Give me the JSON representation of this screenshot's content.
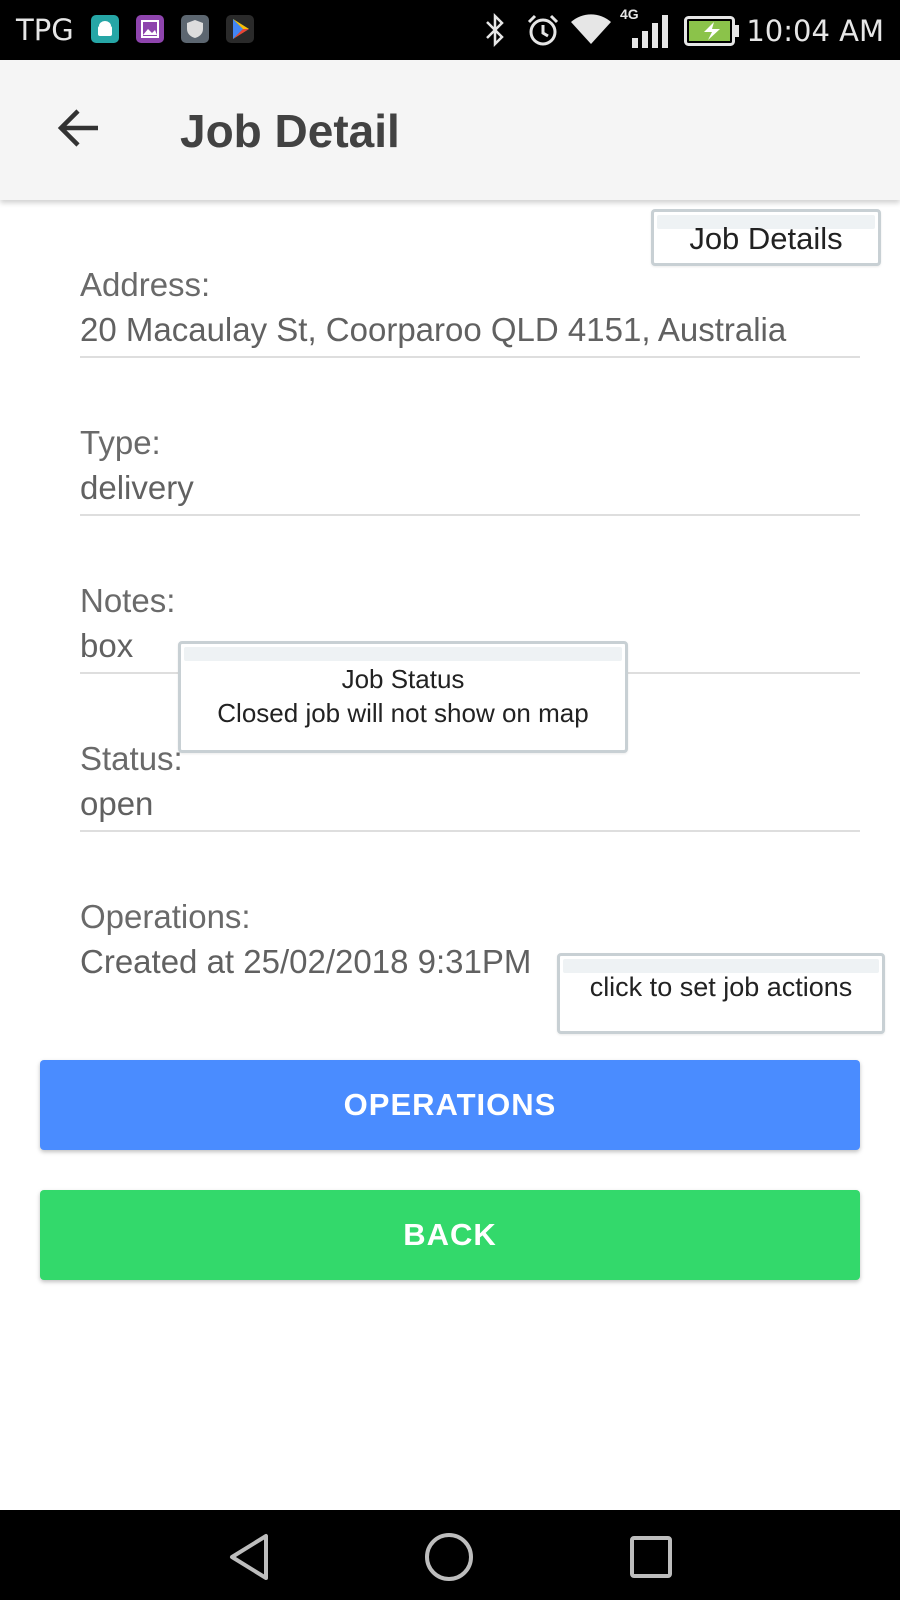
{
  "status_bar": {
    "carrier": "TPG",
    "network": "4G",
    "time": "10:04 AM",
    "icons": [
      "android-icon",
      "gallery-icon",
      "shield-icon",
      "play-store-icon",
      "bluetooth-icon",
      "alarm-icon",
      "wifi-icon",
      "signal-icon",
      "battery-icon"
    ]
  },
  "app_bar": {
    "title": "Job Detail",
    "back_icon": "arrow-left-icon"
  },
  "fields": {
    "address": {
      "label": "Address:",
      "value": "20 Macaulay St, Coorparoo QLD 4151, Australia"
    },
    "type": {
      "label": "Type:",
      "value": "delivery"
    },
    "notes": {
      "label": "Notes:",
      "value": "box"
    },
    "status": {
      "label": "Status:",
      "value": "open"
    },
    "operations": {
      "label": "Operations:",
      "value": "Created at 25/02/2018 9:31PM"
    }
  },
  "buttons": {
    "operations": "OPERATIONS",
    "back": "BACK"
  },
  "tooltips": {
    "job_details": "Job Details",
    "job_status_title": "Job Status",
    "job_status_body": "Closed job will not show on map",
    "job_actions": "click to set job actions"
  },
  "colors": {
    "operations_button": "#4a8cff",
    "back_button": "#33d96b",
    "app_bar": "#f5f5f5",
    "tooltip_border": "#c8d0d4"
  },
  "nav_bar": {
    "icons": [
      "nav-back-icon",
      "nav-home-icon",
      "nav-recents-icon"
    ]
  }
}
